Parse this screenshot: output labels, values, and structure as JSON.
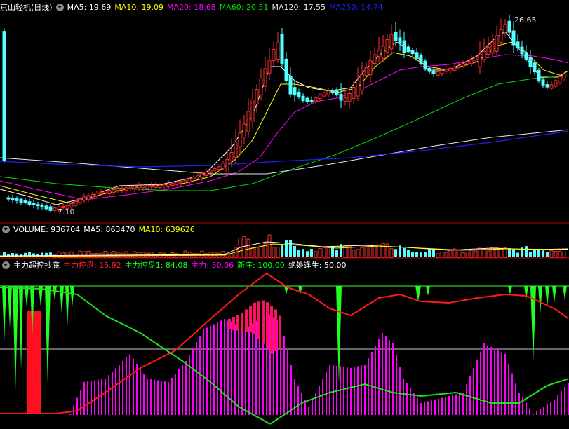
{
  "main": {
    "title": "京山轻机(日线)",
    "indicators": [
      {
        "label": "MA5: 19.69",
        "color": "#ffffff"
      },
      {
        "label": "MA10: 19.09",
        "color": "#ffff00"
      },
      {
        "label": "MA20: 18.68",
        "color": "#ff00ff"
      },
      {
        "label": "MA60: 20.51",
        "color": "#00e000"
      },
      {
        "label": "MA120: 17.55",
        "color": "#e8e8e8"
      },
      {
        "label": "MA250: 14.74",
        "color": "#2020ff"
      }
    ],
    "high_label": "26.65",
    "low_label": "7.10"
  },
  "volume": {
    "indicators": [
      {
        "label": "VOLUME: 936704",
        "color": "#ffffff"
      },
      {
        "label": "MA5: 863470",
        "color": "#ffffff"
      },
      {
        "label": "MA10: 639626",
        "color": "#ffff00"
      }
    ]
  },
  "sub": {
    "indicators": [
      {
        "label": "主力超控抄底",
        "color": "#ffffff"
      },
      {
        "label": "主力控盘: 15.92",
        "color": "#ff2020"
      },
      {
        "label": "主力控盘1: 84.08",
        "color": "#20ff20"
      },
      {
        "label": "主力: 50.06",
        "color": "#ff00ff"
      },
      {
        "label": "新庄: 100.00",
        "color": "#00ff00"
      },
      {
        "label": "绝处逢生: 50.00",
        "color": "#ffffff"
      }
    ]
  },
  "colors": {
    "up": "#ff3030",
    "down": "#54ffff",
    "divider": "#c00000"
  }
}
